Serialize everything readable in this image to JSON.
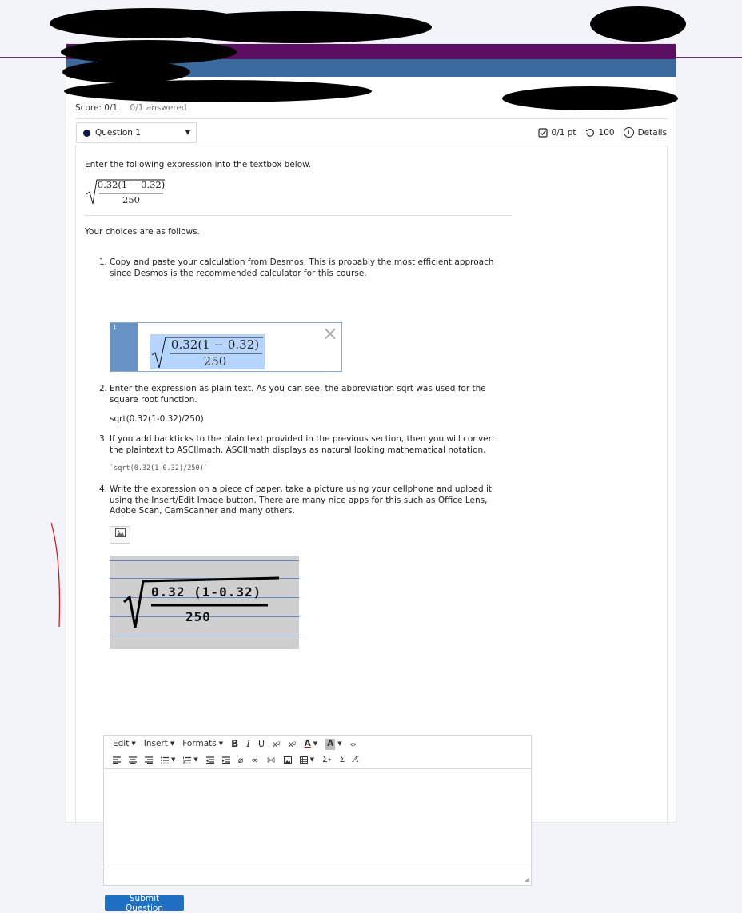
{
  "score": {
    "label": "Score: 0/1",
    "answered": "0/1 answered"
  },
  "question_select": {
    "label": "Question 1"
  },
  "meta": {
    "points": "0/1 pt",
    "attempts": "100",
    "details": "Details"
  },
  "question": {
    "prompt": "Enter the following expression into the textbox below.",
    "expression": {
      "numerator": "0.32(1 − 0.32)",
      "denominator": "250"
    },
    "choices_intro": "Your choices are as follows.",
    "choices": [
      {
        "num": "1.",
        "text": "Copy and paste your calculation from Desmos. This is probably the most efficient approach since Desmos is the recommended calculator for this course."
      },
      {
        "num": "2.",
        "text": "Enter the expression as plain text. As you can see, the abbreviation sqrt was used for the square root function."
      },
      {
        "num": "3.",
        "text": "If you add backticks to the plain text provided in the previous section, then you will convert the plaintext to ASCIImath. ASCIImath displays as natural looking mathematical notation."
      },
      {
        "num": "4.",
        "text": "Write the expression on a piece of paper, take a picture using your cellphone and upload it using the Insert/Edit Image button.  There are many nice apps for this such as Office Lens, Adobe Scan, CamScanner and many others."
      }
    ],
    "desmos": {
      "line_number": "1",
      "numerator": "0.32(1 − 0.32)",
      "denominator": "250"
    },
    "plain_text": "sqrt(0.32(1-0.32)/250)",
    "asciimath": "`sqrt(0.32(1-0.32)/250)`",
    "handwritten": {
      "numerator": "0.32 (1-0.32)",
      "denominator": "250"
    }
  },
  "editor": {
    "menus": [
      "Edit",
      "Insert",
      "Formats"
    ]
  },
  "submit_label": "Submit Question",
  "colors": {
    "purple": "#5b0f62",
    "blue": "#3b6a9f",
    "button": "#1f6fc4"
  },
  "icons": [
    "checkbox-icon",
    "retry-icon",
    "info-icon",
    "image-icon",
    "close-icon"
  ]
}
